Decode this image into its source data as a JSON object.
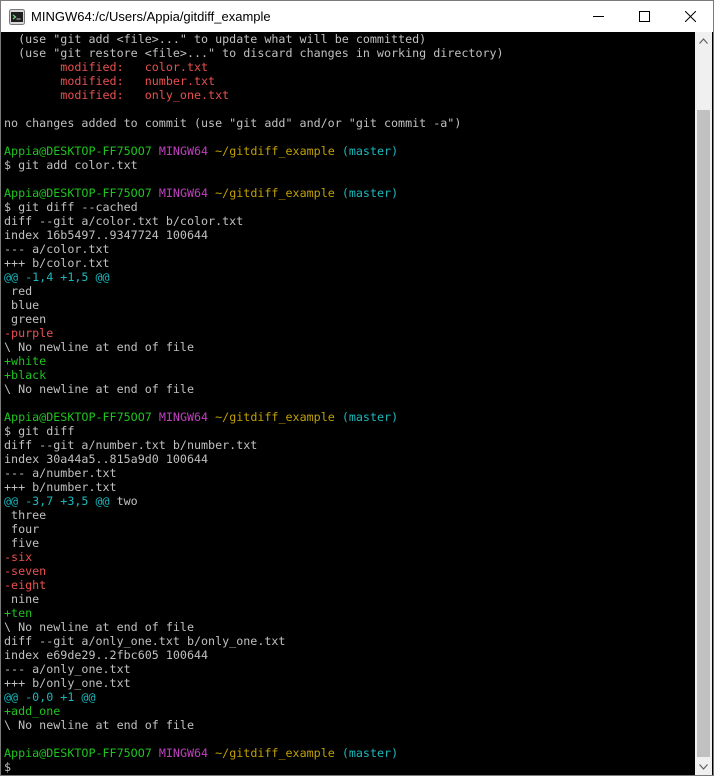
{
  "window": {
    "title": "MINGW64:/c/Users/Appia/gitdiff_example",
    "icon": "mingw-icon",
    "controls": [
      "minimize-icon",
      "maximize-icon",
      "close-icon"
    ]
  },
  "colors": {
    "background": "#000000",
    "default_text": "#c0c0c0",
    "red": "#e8504f",
    "green": "#1fc31f",
    "cyan": "#1ab8bd",
    "magenta": "#bf40bf",
    "yellow": "#c0a000"
  },
  "terminal": {
    "lines": [
      {
        "type": "plain",
        "text": "  (use \"git add <file>...\" to update what will be committed)"
      },
      {
        "type": "plain",
        "text": "  (use \"git restore <file>...\" to discard changes in working directory)"
      },
      {
        "type": "modified",
        "text": "        modified:   color.txt"
      },
      {
        "type": "modified",
        "text": "        modified:   number.txt"
      },
      {
        "type": "modified",
        "text": "        modified:   only_one.txt"
      },
      {
        "type": "blank",
        "text": ""
      },
      {
        "type": "plain",
        "text": "no changes added to commit (use \"git add\" and/or \"git commit -a\")"
      },
      {
        "type": "blank",
        "text": ""
      },
      {
        "type": "prompt",
        "user": "Appia@DESKTOP-FF75OO7",
        "sys": "MINGW64",
        "path": "~/gitdiff_example",
        "branch": "(master)"
      },
      {
        "type": "command",
        "text": "$ git add color.txt"
      },
      {
        "type": "blank",
        "text": ""
      },
      {
        "type": "prompt",
        "user": "Appia@DESKTOP-FF75OO7",
        "sys": "MINGW64",
        "path": "~/gitdiff_example",
        "branch": "(master)"
      },
      {
        "type": "command",
        "text": "$ git diff --cached"
      },
      {
        "type": "header",
        "text": "diff --git a/color.txt b/color.txt"
      },
      {
        "type": "header",
        "text": "index 16b5497..9347724 100644"
      },
      {
        "type": "header",
        "text": "--- a/color.txt"
      },
      {
        "type": "header",
        "text": "+++ b/color.txt"
      },
      {
        "type": "hunk",
        "text": "@@ -1,4 +1,5 @@",
        "ctx": ""
      },
      {
        "type": "context",
        "text": " red"
      },
      {
        "type": "context",
        "text": " blue"
      },
      {
        "type": "context",
        "text": " green"
      },
      {
        "type": "removed",
        "text": "-purple"
      },
      {
        "type": "context",
        "text": "\\ No newline at end of file"
      },
      {
        "type": "added",
        "text": "+white"
      },
      {
        "type": "added",
        "text": "+black"
      },
      {
        "type": "context",
        "text": "\\ No newline at end of file"
      },
      {
        "type": "blank",
        "text": ""
      },
      {
        "type": "prompt",
        "user": "Appia@DESKTOP-FF75OO7",
        "sys": "MINGW64",
        "path": "~/gitdiff_example",
        "branch": "(master)"
      },
      {
        "type": "command",
        "text": "$ git diff"
      },
      {
        "type": "header",
        "text": "diff --git a/number.txt b/number.txt"
      },
      {
        "type": "header",
        "text": "index 30a44a5..815a9d0 100644"
      },
      {
        "type": "header",
        "text": "--- a/number.txt"
      },
      {
        "type": "header",
        "text": "+++ b/number.txt"
      },
      {
        "type": "hunk",
        "text": "@@ -3,7 +3,5 @@",
        "ctx": " two"
      },
      {
        "type": "context",
        "text": " three"
      },
      {
        "type": "context",
        "text": " four"
      },
      {
        "type": "context",
        "text": " five"
      },
      {
        "type": "removed",
        "text": "-six"
      },
      {
        "type": "removed",
        "text": "-seven"
      },
      {
        "type": "removed",
        "text": "-eight"
      },
      {
        "type": "context",
        "text": " nine"
      },
      {
        "type": "added",
        "text": "+ten"
      },
      {
        "type": "context",
        "text": "\\ No newline at end of file"
      },
      {
        "type": "header",
        "text": "diff --git a/only_one.txt b/only_one.txt"
      },
      {
        "type": "header",
        "text": "index e69de29..2fbc605 100644"
      },
      {
        "type": "header",
        "text": "--- a/only_one.txt"
      },
      {
        "type": "header",
        "text": "+++ b/only_one.txt"
      },
      {
        "type": "hunk",
        "text": "@@ -0,0 +1 @@",
        "ctx": ""
      },
      {
        "type": "added",
        "text": "+add_one"
      },
      {
        "type": "context",
        "text": "\\ No newline at end of file"
      },
      {
        "type": "blank",
        "text": ""
      },
      {
        "type": "prompt",
        "user": "Appia@DESKTOP-FF75OO7",
        "sys": "MINGW64",
        "path": "~/gitdiff_example",
        "branch": "(master)"
      },
      {
        "type": "command",
        "text": "$ "
      }
    ]
  }
}
